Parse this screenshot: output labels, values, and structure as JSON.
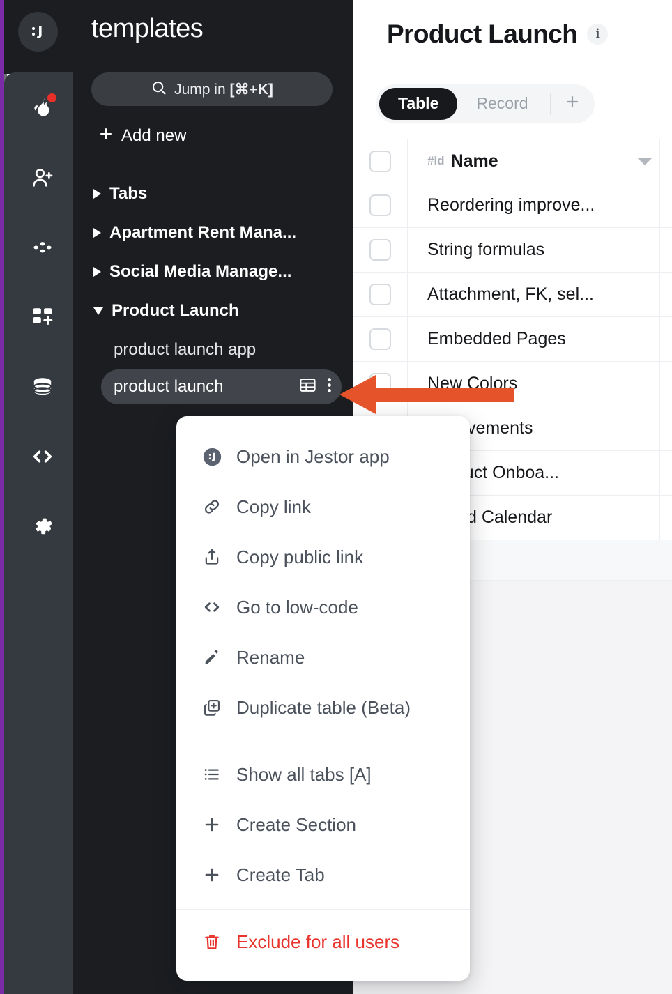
{
  "workspace": {
    "logo_icon": "jestor-smiley-icon",
    "name": "templates"
  },
  "rail": {
    "items": [
      {
        "icon": "flame-icon",
        "name": "whats-new",
        "badge": true
      },
      {
        "icon": "add-user-icon",
        "name": "invite-users",
        "badge": false
      },
      {
        "icon": "automations-dots-icon",
        "name": "automations",
        "badge": false
      },
      {
        "icon": "apps-grid-plus-icon",
        "name": "apps",
        "badge": false
      },
      {
        "icon": "database-icon",
        "name": "database",
        "badge": false
      },
      {
        "icon": "code-brackets-icon",
        "name": "low-code",
        "badge": false
      },
      {
        "icon": "gear-icon",
        "name": "settings",
        "badge": false
      }
    ]
  },
  "search": {
    "icon": "search-icon",
    "label": "Jump in ",
    "shortcut": "[⌘+K]"
  },
  "add_new": {
    "icon": "plus-icon",
    "label": "Add new"
  },
  "tree": {
    "groups": [
      {
        "label": "Tabs",
        "expanded": false
      },
      {
        "label": "Apartment Rent Mana...",
        "expanded": false
      },
      {
        "label": "Social Media Manage...",
        "expanded": false
      },
      {
        "label": "Product Launch",
        "expanded": true
      }
    ],
    "children": [
      {
        "label": "product launch app",
        "selected": false
      },
      {
        "label": "product launch",
        "selected": true,
        "table_icon": "table-grid-icon",
        "menu_icon": "kebab-menu-icon"
      }
    ]
  },
  "content": {
    "title": "Product Launch",
    "info_icon": "info-icon",
    "info_glyph": "i",
    "tabs": [
      {
        "label": "Table",
        "active": true
      },
      {
        "label": "Record",
        "active": false
      }
    ],
    "add_tab_icon": "plus-icon"
  },
  "table": {
    "columns": [
      {
        "id_label": "#id",
        "label": "Name",
        "sort_icon": "chevron-down-icon"
      }
    ],
    "rows": [
      {
        "name": "Reordering improve...",
        "checked": false
      },
      {
        "name": "String formulas",
        "checked": false
      },
      {
        "name": "Attachment, FK, sel...",
        "checked": false
      },
      {
        "name": "Embedded Pages",
        "checked": false
      },
      {
        "name": "New Colors",
        "checked": false
      },
      {
        "name": "mprovements",
        "checked": false
      },
      {
        "name": " Product Onboa...",
        "checked": false
      },
      {
        "name": "grated Calendar",
        "checked": false
      }
    ]
  },
  "context_menu": {
    "items": [
      {
        "label": "Open in Jestor app",
        "icon": "jestor-app-icon",
        "danger": false
      },
      {
        "label": "Copy link",
        "icon": "link-icon",
        "danger": false
      },
      {
        "label": "Copy public link",
        "icon": "share-upload-icon",
        "danger": false
      },
      {
        "label": "Go to low-code",
        "icon": "code-brackets-icon",
        "danger": false
      },
      {
        "label": "Rename",
        "icon": "pencil-icon",
        "danger": false
      },
      {
        "label": "Duplicate table (Beta)",
        "icon": "duplicate-icon",
        "danger": false
      },
      {
        "label": "Show all tabs [A]",
        "icon": "list-icon",
        "danger": false
      },
      {
        "label": "Create Section",
        "icon": "plus-icon",
        "danger": false
      },
      {
        "label": "Create Tab",
        "icon": "plus-icon",
        "danger": false
      },
      {
        "label": "Exclude for all users",
        "icon": "trash-icon",
        "danger": true
      }
    ]
  },
  "annotation": {
    "type": "arrow-left",
    "color": "#e4532a"
  },
  "colors": {
    "accent_purple": "#7b2aa8",
    "panel_dark": "#1b1d21",
    "rail_dark": "#343a40",
    "selected_pill": "#41454b",
    "danger_red": "#e8342d",
    "annotation_orange": "#e4532a",
    "tab_active_bg": "#17191c"
  }
}
